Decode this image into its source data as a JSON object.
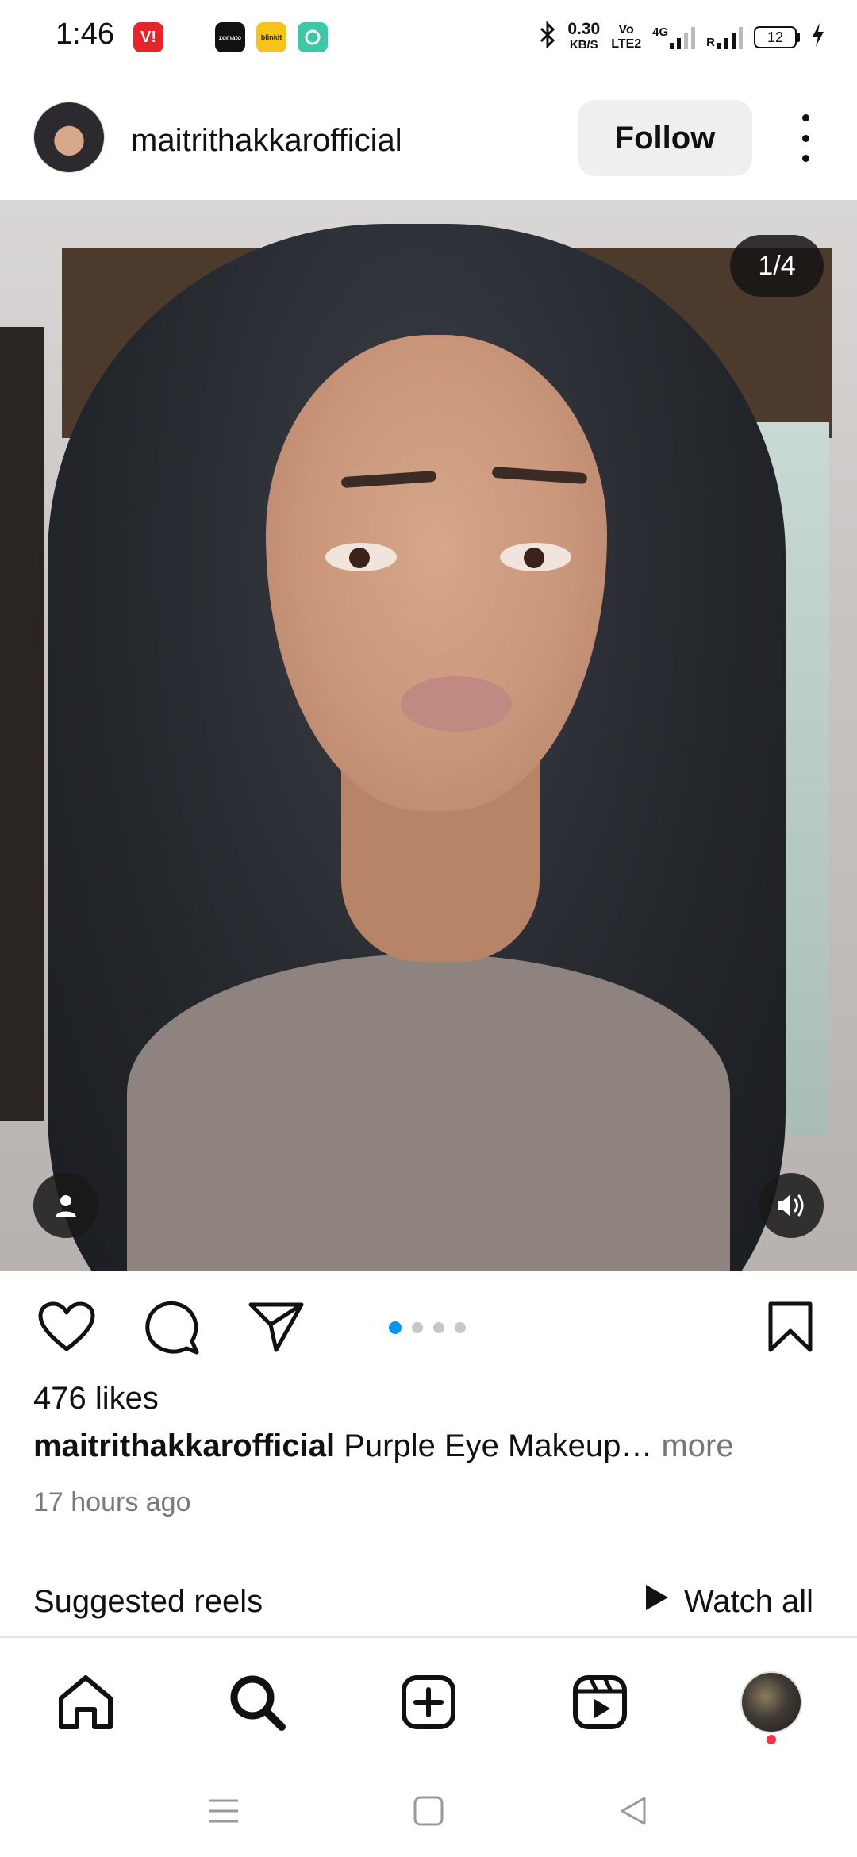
{
  "status_bar": {
    "time": "1:46",
    "apps": [
      {
        "name": "vi-app-icon",
        "label": "V!",
        "color": "#e5242b"
      },
      {
        "name": "zomato-app-icon",
        "label": "zomato",
        "color": "#111111"
      },
      {
        "name": "blinkit-app-icon",
        "label": "blinkit",
        "color": "#f7c21a"
      },
      {
        "name": "chat-app-icon",
        "label": "",
        "color": "#3cc7a5"
      }
    ],
    "net_speed": "0.30",
    "net_unit": "KB/S",
    "volte_top": "Vo",
    "volte_bottom": "LTE2",
    "network_type": "4G",
    "roaming": "R",
    "battery": "12"
  },
  "header": {
    "username": "maitrithakkarofficial",
    "follow_label": "Follow"
  },
  "media": {
    "page_counter": "1/4",
    "carousel_total": 4,
    "carousel_index": 1
  },
  "post": {
    "likes": "476 likes",
    "caption_user": "maitrithakkarofficial",
    "caption_text": " Purple Eye Makeup",
    "caption_ellipsis": "…",
    "caption_more": " more",
    "timestamp": "17 hours ago"
  },
  "suggested": {
    "title": "Suggested reels",
    "watch_all": "Watch all"
  },
  "colors": {
    "accent_blue": "#0095f6",
    "notification_red": "#ff3040",
    "follow_bg": "#efefef"
  },
  "icons": [
    "heart-icon",
    "comment-icon",
    "share-icon",
    "bookmark-icon",
    "home-icon",
    "search-icon",
    "create-icon",
    "reels-icon",
    "profile-avatar",
    "person-tag-icon",
    "speaker-icon",
    "play-icon"
  ]
}
